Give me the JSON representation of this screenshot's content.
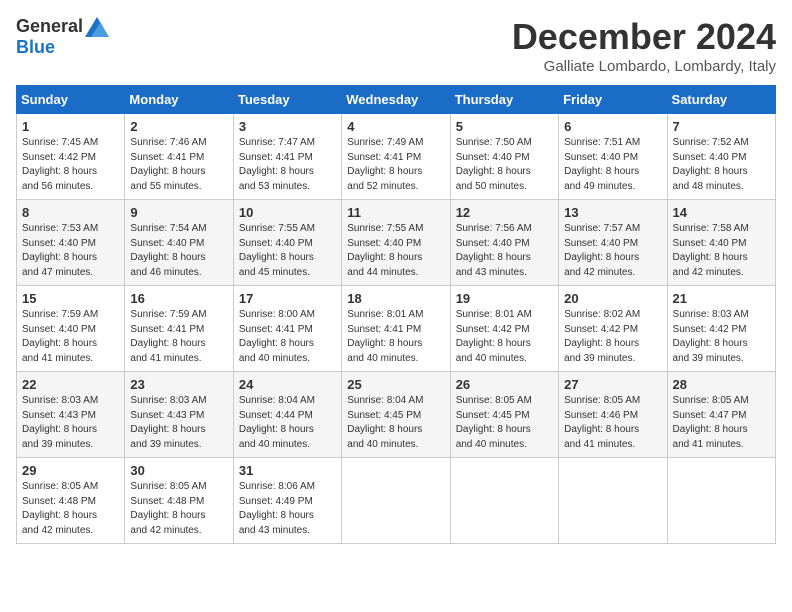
{
  "logo": {
    "general": "General",
    "blue": "Blue"
  },
  "title": "December 2024",
  "location": "Galliate Lombardo, Lombardy, Italy",
  "days_of_week": [
    "Sunday",
    "Monday",
    "Tuesday",
    "Wednesday",
    "Thursday",
    "Friday",
    "Saturday"
  ],
  "weeks": [
    [
      {
        "day": "1",
        "sunrise": "7:45 AM",
        "sunset": "4:42 PM",
        "daylight": "8 hours and 56 minutes."
      },
      {
        "day": "2",
        "sunrise": "7:46 AM",
        "sunset": "4:41 PM",
        "daylight": "8 hours and 55 minutes."
      },
      {
        "day": "3",
        "sunrise": "7:47 AM",
        "sunset": "4:41 PM",
        "daylight": "8 hours and 53 minutes."
      },
      {
        "day": "4",
        "sunrise": "7:49 AM",
        "sunset": "4:41 PM",
        "daylight": "8 hours and 52 minutes."
      },
      {
        "day": "5",
        "sunrise": "7:50 AM",
        "sunset": "4:40 PM",
        "daylight": "8 hours and 50 minutes."
      },
      {
        "day": "6",
        "sunrise": "7:51 AM",
        "sunset": "4:40 PM",
        "daylight": "8 hours and 49 minutes."
      },
      {
        "day": "7",
        "sunrise": "7:52 AM",
        "sunset": "4:40 PM",
        "daylight": "8 hours and 48 minutes."
      }
    ],
    [
      {
        "day": "8",
        "sunrise": "7:53 AM",
        "sunset": "4:40 PM",
        "daylight": "8 hours and 47 minutes."
      },
      {
        "day": "9",
        "sunrise": "7:54 AM",
        "sunset": "4:40 PM",
        "daylight": "8 hours and 46 minutes."
      },
      {
        "day": "10",
        "sunrise": "7:55 AM",
        "sunset": "4:40 PM",
        "daylight": "8 hours and 45 minutes."
      },
      {
        "day": "11",
        "sunrise": "7:55 AM",
        "sunset": "4:40 PM",
        "daylight": "8 hours and 44 minutes."
      },
      {
        "day": "12",
        "sunrise": "7:56 AM",
        "sunset": "4:40 PM",
        "daylight": "8 hours and 43 minutes."
      },
      {
        "day": "13",
        "sunrise": "7:57 AM",
        "sunset": "4:40 PM",
        "daylight": "8 hours and 42 minutes."
      },
      {
        "day": "14",
        "sunrise": "7:58 AM",
        "sunset": "4:40 PM",
        "daylight": "8 hours and 42 minutes."
      }
    ],
    [
      {
        "day": "15",
        "sunrise": "7:59 AM",
        "sunset": "4:40 PM",
        "daylight": "8 hours and 41 minutes."
      },
      {
        "day": "16",
        "sunrise": "7:59 AM",
        "sunset": "4:41 PM",
        "daylight": "8 hours and 41 minutes."
      },
      {
        "day": "17",
        "sunrise": "8:00 AM",
        "sunset": "4:41 PM",
        "daylight": "8 hours and 40 minutes."
      },
      {
        "day": "18",
        "sunrise": "8:01 AM",
        "sunset": "4:41 PM",
        "daylight": "8 hours and 40 minutes."
      },
      {
        "day": "19",
        "sunrise": "8:01 AM",
        "sunset": "4:42 PM",
        "daylight": "8 hours and 40 minutes."
      },
      {
        "day": "20",
        "sunrise": "8:02 AM",
        "sunset": "4:42 PM",
        "daylight": "8 hours and 39 minutes."
      },
      {
        "day": "21",
        "sunrise": "8:03 AM",
        "sunset": "4:42 PM",
        "daylight": "8 hours and 39 minutes."
      }
    ],
    [
      {
        "day": "22",
        "sunrise": "8:03 AM",
        "sunset": "4:43 PM",
        "daylight": "8 hours and 39 minutes."
      },
      {
        "day": "23",
        "sunrise": "8:03 AM",
        "sunset": "4:43 PM",
        "daylight": "8 hours and 39 minutes."
      },
      {
        "day": "24",
        "sunrise": "8:04 AM",
        "sunset": "4:44 PM",
        "daylight": "8 hours and 40 minutes."
      },
      {
        "day": "25",
        "sunrise": "8:04 AM",
        "sunset": "4:45 PM",
        "daylight": "8 hours and 40 minutes."
      },
      {
        "day": "26",
        "sunrise": "8:05 AM",
        "sunset": "4:45 PM",
        "daylight": "8 hours and 40 minutes."
      },
      {
        "day": "27",
        "sunrise": "8:05 AM",
        "sunset": "4:46 PM",
        "daylight": "8 hours and 41 minutes."
      },
      {
        "day": "28",
        "sunrise": "8:05 AM",
        "sunset": "4:47 PM",
        "daylight": "8 hours and 41 minutes."
      }
    ],
    [
      {
        "day": "29",
        "sunrise": "8:05 AM",
        "sunset": "4:48 PM",
        "daylight": "8 hours and 42 minutes."
      },
      {
        "day": "30",
        "sunrise": "8:05 AM",
        "sunset": "4:48 PM",
        "daylight": "8 hours and 42 minutes."
      },
      {
        "day": "31",
        "sunrise": "8:06 AM",
        "sunset": "4:49 PM",
        "daylight": "8 hours and 43 minutes."
      },
      null,
      null,
      null,
      null
    ]
  ]
}
